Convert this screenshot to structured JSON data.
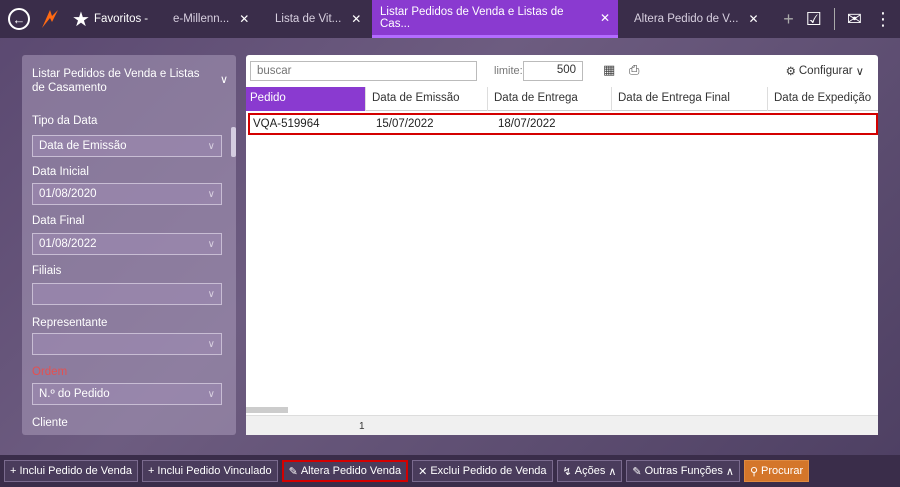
{
  "topbar": {
    "favorites_label": "Favoritos",
    "tabs": [
      {
        "label": "e-Millenn..."
      },
      {
        "label": "Lista de Vit..."
      },
      {
        "label": "Listar Pedidos de Venda e Listas de Cas..."
      },
      {
        "label": "Altera Pedido de V..."
      }
    ]
  },
  "filters": {
    "title": "Listar Pedidos de Venda e Listas de Casamento",
    "tipo_data_label": "Tipo da Data",
    "tipo_data_value": "Data de Emissão",
    "data_inicial_label": "Data Inicial",
    "data_inicial_value": "01/08/2020",
    "data_final_label": "Data Final",
    "data_final_value": "01/08/2022",
    "filiais_label": "Filiais",
    "filiais_value": "",
    "representante_label": "Representante",
    "representante_value": "",
    "ordem_label": "Ordem",
    "ordem_value": "N.º do Pedido",
    "cliente_label": "Cliente"
  },
  "grid": {
    "search_placeholder": "buscar",
    "limite_label": "limite:",
    "limite_value": "500",
    "config_label": "Configurar",
    "columns": [
      "Pedido",
      "Data de Emissão",
      "Data de Entrega",
      "Data de Entrega Final",
      "Data de Expedição"
    ],
    "rows": [
      {
        "pedido": "VQA-519964",
        "emissao": "15/07/2022",
        "entrega": "18/07/2022",
        "entrega_final": "",
        "expedicao": ""
      }
    ],
    "page": "1"
  },
  "toolbar": {
    "inclui_pedido": "Inclui Pedido de Venda",
    "inclui_vinculado": "Inclui Pedido Vinculado",
    "altera_pedido": "Altera Pedido Venda",
    "exclui_pedido": "Exclui Pedido de Venda",
    "acoes": "Ações",
    "outras_funcoes": "Outras Funções",
    "procurar": "Procurar"
  }
}
